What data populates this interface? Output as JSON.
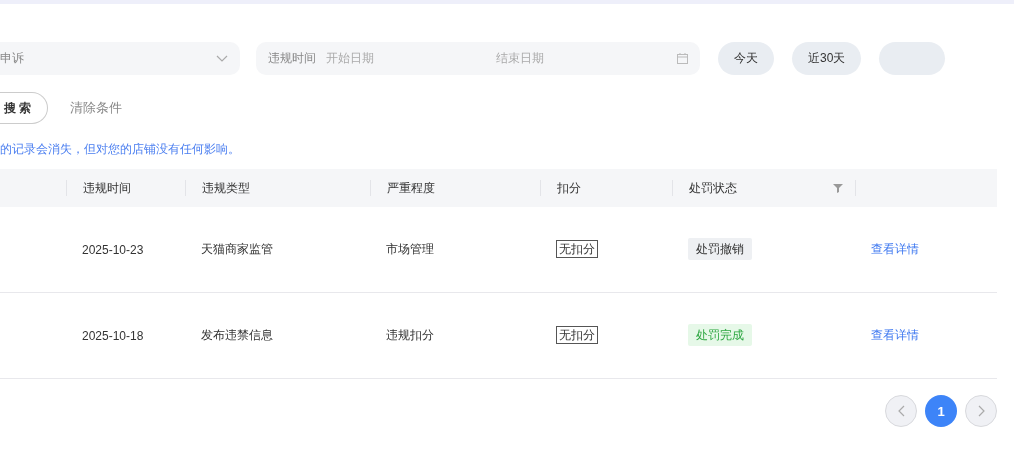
{
  "filters": {
    "appeal_select": {
      "value": "申诉"
    },
    "date_range": {
      "label": "违规时间",
      "start_placeholder": "开始日期",
      "end_placeholder": "结束日期"
    },
    "quick_buttons": [
      {
        "kind": "text",
        "label": "今天"
      },
      {
        "kind": "text",
        "label": "近30天"
      },
      {
        "kind": "blurred"
      }
    ]
  },
  "actions": {
    "search": "搜 索",
    "clear": "清除条件"
  },
  "notice": "的记录会消失，但对您的店铺没有任何影响。",
  "table": {
    "columns": [
      {
        "label": "违规时间",
        "filter": false
      },
      {
        "label": "违规类型",
        "filter": false
      },
      {
        "label": "严重程度",
        "filter": false
      },
      {
        "label": "扣分",
        "filter": false
      },
      {
        "label": "处罚状态",
        "filter": true
      },
      {
        "filter": false
      }
    ],
    "rows": [
      {
        "date": "2025-10-23",
        "type": "天猫商家监管",
        "severity": "市场管理",
        "points": "无扣分",
        "status": "处罚撤销",
        "kind": "revoked",
        "action": "查看详情"
      },
      {
        "date": "2025-10-18",
        "type": "发布违禁信息",
        "severity": "违规扣分",
        "points": "无扣分",
        "status": "处罚完成",
        "kind": "done",
        "action": "查看详情"
      }
    ]
  },
  "pagination": {
    "pages": [
      {
        "label": "1",
        "selected": true
      }
    ]
  }
}
